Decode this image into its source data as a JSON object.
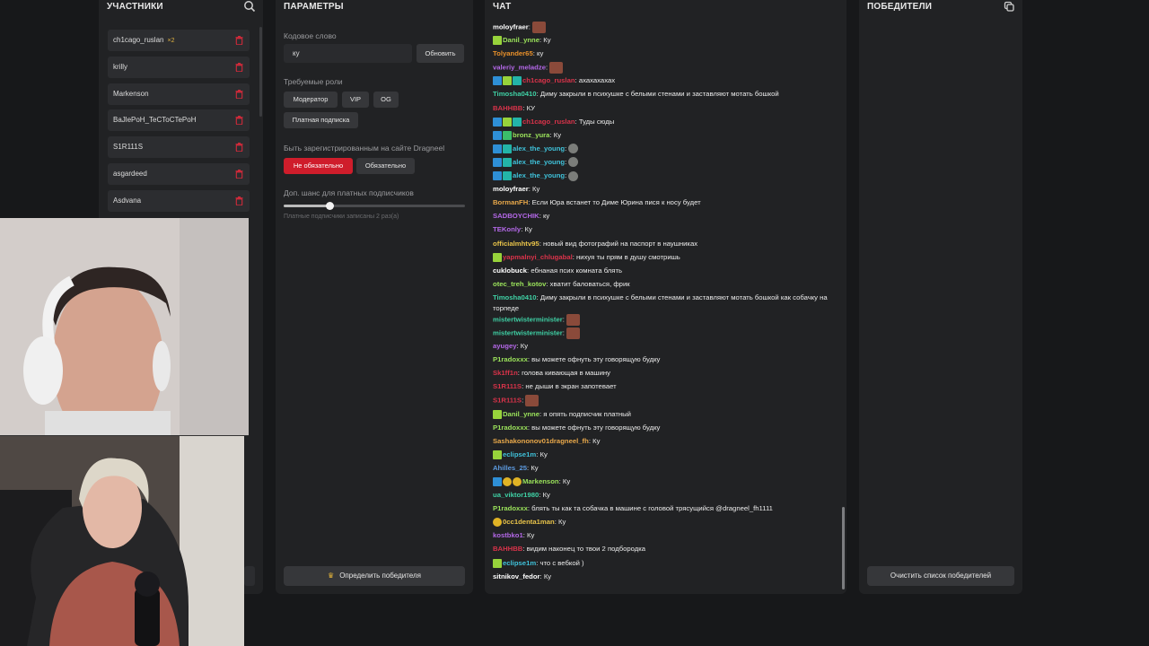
{
  "colors": {
    "accent_red": "#cf1d2b",
    "panel_bg": "#212224",
    "page_bg": "#17181a"
  },
  "participants": {
    "title": "УЧАСТНИКИ",
    "search_icon": "search-icon",
    "items": [
      {
        "name": "ch1cago_ruslan",
        "badge": "×2"
      },
      {
        "name": "krilly",
        "badge": ""
      },
      {
        "name": "Markenson",
        "badge": ""
      },
      {
        "name": "BaJlePoH_TeCToCTePoH",
        "badge": ""
      },
      {
        "name": "S1R111S",
        "badge": ""
      },
      {
        "name": "asgardeed",
        "badge": ""
      },
      {
        "name": "Asdvana",
        "badge": ""
      }
    ]
  },
  "params": {
    "title": "ПАРАМЕТРЫ",
    "codeword_label": "Кодовое слово",
    "codeword_value": "ку",
    "update_btn": "Обновить",
    "roles_label": "Требуемые роли",
    "roles": [
      "Модератор",
      "VIP",
      "OG",
      "Платная подписка"
    ],
    "registered_label": "Быть зарегистрированным на сайте Dragneel",
    "not_required": "Не обязательно",
    "required": "Обязательно",
    "chance_label": "Доп. шанс для платных подписчиков",
    "chance_level": 0.25,
    "chance_note": "Платные подписчики записаны 2 раз(а)",
    "determine_btn": "Определить победителя"
  },
  "chat": {
    "title": "ЧАТ",
    "messages": [
      {
        "user": "moloyfraer",
        "color": "#ffffff",
        "text": "",
        "emote": true,
        "badges": []
      },
      {
        "user": "Danil_ynne",
        "color": "#9be35b",
        "text": "Ку",
        "badges": [
          "lime"
        ]
      },
      {
        "user": "Tolyander65",
        "color": "#e8902a",
        "text": "ку",
        "badges": []
      },
      {
        "user": "valeriy_meladze",
        "color": "#b468e8",
        "text": "",
        "emote": true,
        "badges": []
      },
      {
        "user": "ch1cago_ruslan",
        "color": "#d9334a",
        "text": "ахахахахах",
        "badges": [
          "blue",
          "lime",
          "teal"
        ]
      },
      {
        "user": "Timosha0410",
        "color": "#3fd1a5",
        "text": "Диму закрыли в психушке с белыми стенами и заставляют мотать бошкой",
        "badges": []
      },
      {
        "user": "BAHHBB",
        "color": "#d9334a",
        "text": "КУ",
        "badges": []
      },
      {
        "user": "ch1cago_ruslan",
        "color": "#d9334a",
        "text": "Туды сюды",
        "badges": [
          "blue",
          "lime",
          "teal"
        ]
      },
      {
        "user": "bronz_yura",
        "color": "#9be35b",
        "text": "Ку",
        "badges": [
          "blue",
          "green"
        ]
      },
      {
        "user": "alex_the_young",
        "color": "#3fc1d9",
        "text": "",
        "emote2": true,
        "badges": [
          "blue",
          "teal"
        ]
      },
      {
        "user": "alex_the_young",
        "color": "#3fc1d9",
        "text": "",
        "emote2": true,
        "badges": [
          "blue",
          "teal"
        ]
      },
      {
        "user": "alex_the_young",
        "color": "#3fc1d9",
        "text": "",
        "emote2": true,
        "badges": [
          "blue",
          "teal"
        ]
      },
      {
        "user": "moloyfraer",
        "color": "#ffffff",
        "text": "Ку",
        "badges": []
      },
      {
        "user": "BormanFH",
        "color": "#e8a84a",
        "text": "Если Юра встанет то Диме Юрина пися к носу будет",
        "badges": []
      },
      {
        "user": "SADBOYCHIK",
        "color": "#b468e8",
        "text": "ку",
        "badges": []
      },
      {
        "user": "TEKonly",
        "color": "#b468e8",
        "text": "Ку",
        "badges": []
      },
      {
        "user": "officialmhtv95",
        "color": "#e8c34a",
        "text": "новый вид фотографий на паспорт в наушниках",
        "badges": []
      },
      {
        "user": "yapmalnyi_chlugabal",
        "color": "#d9334a",
        "text": "нихуя ты прям в душу смотришь",
        "badges": [
          "lime"
        ]
      },
      {
        "user": "cuklobuck",
        "color": "#ffffff",
        "text": "ебнаная псих комната блять",
        "badges": []
      },
      {
        "user": "otec_treh_kotov",
        "color": "#9be35b",
        "text": "хватит баловаться, фрик",
        "badges": []
      },
      {
        "user": "Timosha0410",
        "color": "#3fd1a5",
        "text": "Диму закрыли в психушке с белыми стенами и заставляют мотать бошкой как собачку на торпеде",
        "badges": []
      },
      {
        "user": "mistertwisterminister",
        "color": "#3fd1a5",
        "text": "",
        "emote": true,
        "badges": []
      },
      {
        "user": "mistertwisterminister",
        "color": "#3fd1a5",
        "text": "",
        "emote": true,
        "badges": []
      },
      {
        "user": "ayugey",
        "color": "#b468e8",
        "text": "Ку",
        "badges": []
      },
      {
        "user": "P1radoxxx",
        "color": "#9be35b",
        "text": "вы можете офнуть эту говорящую будку",
        "badges": []
      },
      {
        "user": "Sk1ff1n",
        "color": "#d9334a",
        "text": "голова кивающая в машину",
        "badges": []
      },
      {
        "user": "S1R111S",
        "color": "#d9334a",
        "text": "не дыши в экран запотевает",
        "badges": []
      },
      {
        "user": "S1R111S",
        "color": "#d9334a",
        "text": "",
        "emote": true,
        "badges": []
      },
      {
        "user": "Danil_ynne",
        "color": "#9be35b",
        "text": "я опять подписчик платный",
        "badges": [
          "lime"
        ]
      },
      {
        "user": "P1radoxxx",
        "color": "#9be35b",
        "text": "вы можете офнуть эту говорящую будку",
        "badges": []
      },
      {
        "user": "Sashakononov01dragneel_fh",
        "color": "#e8a84a",
        "text": "Ку",
        "badges": []
      },
      {
        "user": "eclipse1m",
        "color": "#3fc1d9",
        "text": "Ку",
        "badges": [
          "lime"
        ]
      },
      {
        "user": "Ahilles_25",
        "color": "#5d9be0",
        "text": "Ку",
        "badges": []
      },
      {
        "user": "Markenson",
        "color": "#9be35b",
        "text": "Ку",
        "badges": [
          "blue",
          "yellow",
          "yellow"
        ]
      },
      {
        "user": "ua_viktor1980",
        "color": "#3fd1a5",
        "text": "Ку",
        "badges": []
      },
      {
        "user": "P1radoxxx",
        "color": "#9be35b",
        "text": "блять ты как та собачка в машине с головой трясущийся @dragneel_fh1111",
        "badges": []
      },
      {
        "user": "0cc1denta1man",
        "color": "#e8c34a",
        "text": "Ку",
        "badges": [
          "yellow"
        ]
      },
      {
        "user": "kostbko1",
        "color": "#b468e8",
        "text": "Ку",
        "badges": []
      },
      {
        "user": "BAHHBB",
        "color": "#d9334a",
        "text": "видим наконец то твои 2 подбородка",
        "badges": []
      },
      {
        "user": "eclipse1m",
        "color": "#3fc1d9",
        "text": "что с вебкой )",
        "badges": [
          "lime"
        ]
      },
      {
        "user": "sitnikov_fedor",
        "color": "#ffffff",
        "text": "Ку",
        "badges": []
      }
    ]
  },
  "winners": {
    "title": "ПОБЕДИТЕЛИ",
    "clear_btn": "Очистить список победителей"
  }
}
